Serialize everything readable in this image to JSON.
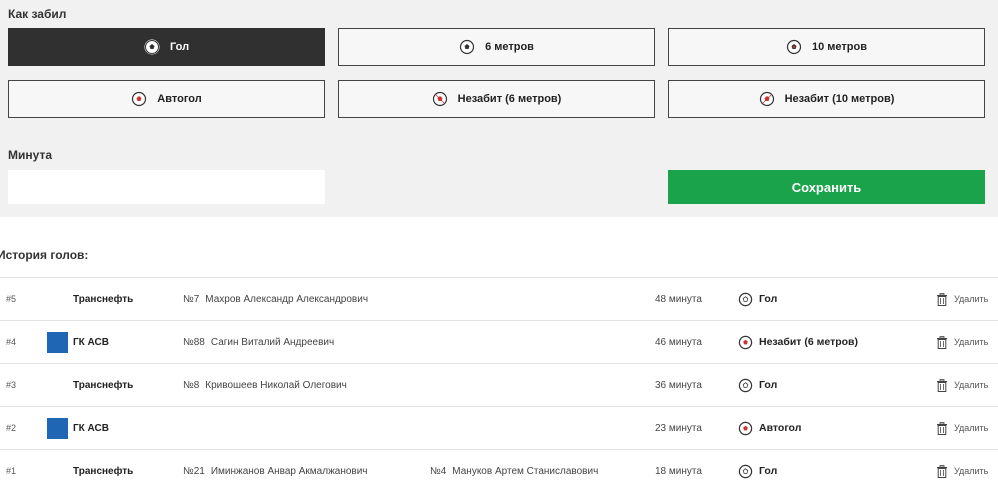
{
  "form": {
    "how_label": "Как забил",
    "goal_types": [
      {
        "label": "Гол",
        "icon": "ball-icon",
        "active": true
      },
      {
        "label": "6 метров",
        "icon": "ball-6m-icon",
        "active": false
      },
      {
        "label": "10 метров",
        "icon": "ball-10m-icon",
        "active": false
      },
      {
        "label": "Автогол",
        "icon": "ball-own-goal-icon",
        "active": false
      },
      {
        "label": "Незабит (6 метров)",
        "icon": "ball-missed-6m-icon",
        "active": false
      },
      {
        "label": "Незабит (10 метров)",
        "icon": "ball-missed-10m-icon",
        "active": false
      }
    ],
    "minute_label": "Минута",
    "minute_value": "",
    "save_label": "Сохранить",
    "save_color": "#1aa34a"
  },
  "history": {
    "title": "История голов:",
    "rows": [
      {
        "num": "#5",
        "team": "Транснефть",
        "has_logo": false,
        "p1_num": "№7",
        "p1_name": "Махров Александр Александрович",
        "p2_num": "",
        "p2_name": "",
        "minute": "48 минута",
        "type": "Гол",
        "type_icon": "ball-icon",
        "delete": "Удалить"
      },
      {
        "num": "#4",
        "team": "ГК АСВ",
        "has_logo": true,
        "p1_num": "№88",
        "p1_name": "Сагин Виталий Андреевич",
        "p2_num": "",
        "p2_name": "",
        "minute": "46 минута",
        "type": "Незабит (6 метров)",
        "type_icon": "ball-missed-6m-icon",
        "delete": "Удалить"
      },
      {
        "num": "#3",
        "team": "Транснефть",
        "has_logo": false,
        "p1_num": "№8",
        "p1_name": "Кривошеев Николай Олегович",
        "p2_num": "",
        "p2_name": "",
        "minute": "36 минута",
        "type": "Гол",
        "type_icon": "ball-icon",
        "delete": "Удалить"
      },
      {
        "num": "#2",
        "team": "ГК АСВ",
        "has_logo": true,
        "p1_num": "",
        "p1_name": "",
        "p2_num": "",
        "p2_name": "",
        "minute": "23 минута",
        "type": "Автогол",
        "type_icon": "ball-own-goal-icon",
        "delete": "Удалить"
      },
      {
        "num": "#1",
        "team": "Транснефть",
        "has_logo": false,
        "p1_num": "№21",
        "p1_name": "Иминжанов Анвар Акмалжанович",
        "p2_num": "№4",
        "p2_name": "Мануков Артем Станиславович",
        "minute": "18 минута",
        "type": "Гол",
        "type_icon": "ball-icon",
        "delete": "Удалить"
      }
    ],
    "logo_color": "#1f66b5"
  }
}
